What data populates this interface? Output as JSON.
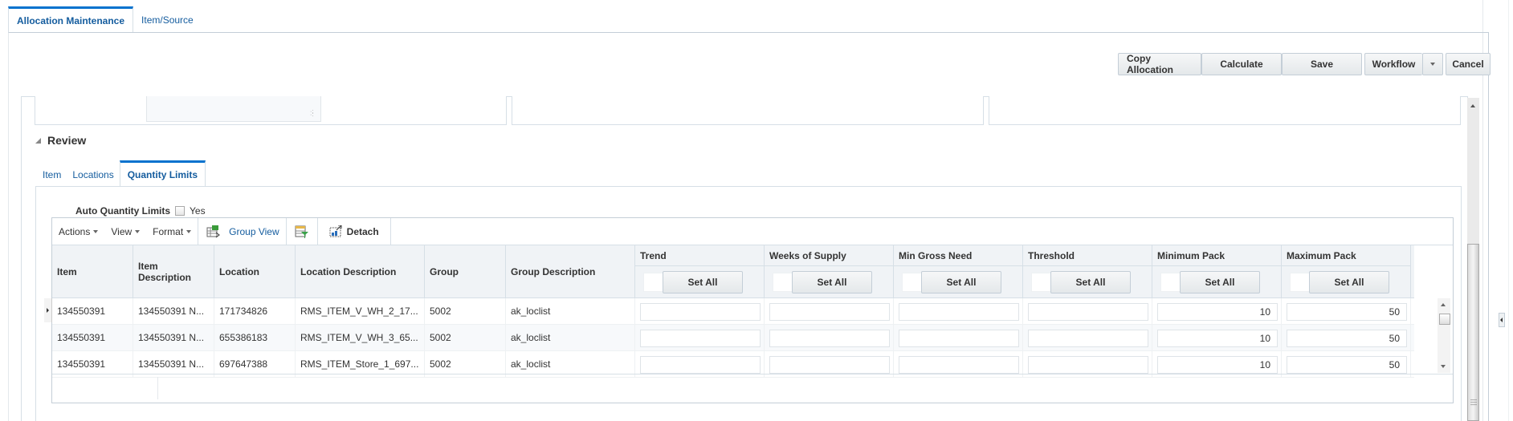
{
  "top_tabs": [
    {
      "label": "Allocation Maintenance",
      "active": true
    },
    {
      "label": "Item/Source",
      "active": false
    }
  ],
  "actions": {
    "copy_allocation": "Copy Allocation",
    "calculate": "Calculate",
    "save": "Save",
    "workflow": "Workflow",
    "cancel": "Cancel"
  },
  "review": {
    "title": "Review",
    "tabs": [
      {
        "label": "Item",
        "active": false
      },
      {
        "label": "Locations",
        "active": false
      },
      {
        "label": "Quantity Limits",
        "active": true
      }
    ],
    "auto_quantity_limits": {
      "label": "Auto Quantity Limits",
      "checkbox_label": "Yes",
      "checked": false
    }
  },
  "toolbar": {
    "actions": "Actions",
    "view": "View",
    "format": "Format",
    "group_view": "Group View",
    "detach": "Detach"
  },
  "table": {
    "columns": [
      "Item",
      "Item Description",
      "Location",
      "Location Description",
      "Group",
      "Group Description"
    ],
    "input_columns": [
      "Trend",
      "Weeks of Supply",
      "Min Gross Need",
      "Threshold",
      "Minimum Pack",
      "Maximum Pack"
    ],
    "set_all_label": "Set All",
    "rows": [
      {
        "item": "134550391",
        "item_desc": "134550391 N...",
        "location": "171734826",
        "location_desc": "RMS_ITEM_V_WH_2_17...",
        "group": "5002",
        "group_desc": "ak_loclist",
        "trend": "",
        "weeks_of_supply": "",
        "min_gross_need": "",
        "threshold": "",
        "minimum_pack": "10",
        "maximum_pack": "50"
      },
      {
        "item": "134550391",
        "item_desc": "134550391 N...",
        "location": "655386183",
        "location_desc": "RMS_ITEM_V_WH_3_65...",
        "group": "5002",
        "group_desc": "ak_loclist",
        "trend": "",
        "weeks_of_supply": "",
        "min_gross_need": "",
        "threshold": "",
        "minimum_pack": "10",
        "maximum_pack": "50"
      },
      {
        "item": "134550391",
        "item_desc": "134550391 N...",
        "location": "697647388",
        "location_desc": "RMS_ITEM_Store_1_697...",
        "group": "5002",
        "group_desc": "ak_loclist",
        "trend": "",
        "weeks_of_supply": "",
        "min_gross_need": "",
        "threshold": "",
        "minimum_pack": "10",
        "maximum_pack": "50"
      }
    ]
  }
}
